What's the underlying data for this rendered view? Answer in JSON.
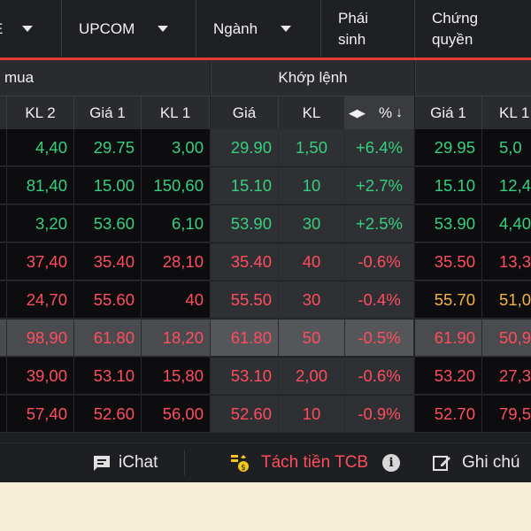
{
  "nav": {
    "items": [
      {
        "label": "E"
      },
      {
        "label": "UPCOM"
      },
      {
        "label": "Ngành"
      },
      {
        "label1": "Phái",
        "label2": "sinh"
      },
      {
        "label1": "Chứng",
        "label2": "quyền"
      }
    ]
  },
  "groups": {
    "buy": "mua",
    "match": "Khớp lệnh"
  },
  "columns": {
    "kl2": "KL 2",
    "gia1": "Giá 1",
    "kl1": "KL 1",
    "gia": "Giá",
    "kl": "KL",
    "pct": "%",
    "sell_gia1": "Giá 1",
    "sell_kl1": "KL 1"
  },
  "colors": {
    "up": "#35d07f",
    "down": "#ff4d5e",
    "ref": "#f5b342",
    "white": "#ffffff"
  },
  "rows": [
    {
      "kl2": "4,40",
      "gia1": "29.75",
      "kl1": "3,00",
      "gia": "29.90",
      "kl": "1,50",
      "pct": "+6.4%",
      "sgia1": "29.95",
      "skl1": "5,0",
      "color": "up",
      "scolor": "up"
    },
    {
      "kl2": "81,40",
      "gia1": "15.00",
      "kl1": "150,60",
      "gia": "15.10",
      "kl": "10",
      "pct": "+2.7%",
      "sgia1": "15.10",
      "skl1": "12,4",
      "color": "up",
      "scolor": "up"
    },
    {
      "kl2": "3,20",
      "gia1": "53.60",
      "kl1": "6,10",
      "gia": "53.90",
      "kl": "30",
      "pct": "+2.5%",
      "sgia1": "53.90",
      "skl1": "4,40",
      "color": "up",
      "scolor": "up"
    },
    {
      "kl2": "37,40",
      "gia1": "35.40",
      "kl1": "28,10",
      "gia": "35.40",
      "kl": "40",
      "pct": "-0.6%",
      "sgia1": "35.50",
      "skl1": "13,3",
      "color": "down",
      "scolor": "down"
    },
    {
      "kl2": "24,70",
      "gia1": "55.60",
      "kl1": "40",
      "gia": "55.50",
      "kl": "30",
      "pct": "-0.4%",
      "sgia1": "55.70",
      "skl1": "51,0",
      "color": "down",
      "scolor": "ref"
    },
    {
      "kl2": "98,90",
      "gia1": "61.80",
      "kl1": "18,20",
      "gia": "61.80",
      "kl": "50",
      "pct": "-0.5%",
      "sgia1": "61.90",
      "skl1": "50,9",
      "color": "down",
      "scolor": "down"
    },
    {
      "kl2": "39,00",
      "gia1": "53.10",
      "kl1": "15,80",
      "gia": "53.10",
      "kl": "2,00",
      "pct": "-0.6%",
      "sgia1": "53.20",
      "skl1": "27,3",
      "color": "down",
      "scolor": "down"
    },
    {
      "kl2": "57,40",
      "gia1": "52.60",
      "kl1": "56,00",
      "gia": "52.60",
      "kl": "10",
      "pct": "-0.9%",
      "sgia1": "52.70",
      "skl1": "79,5",
      "color": "down",
      "scolor": "down"
    }
  ],
  "footer": {
    "ichat": "iChat",
    "split": "Tách tiền TCB",
    "note": "Ghi chú"
  }
}
